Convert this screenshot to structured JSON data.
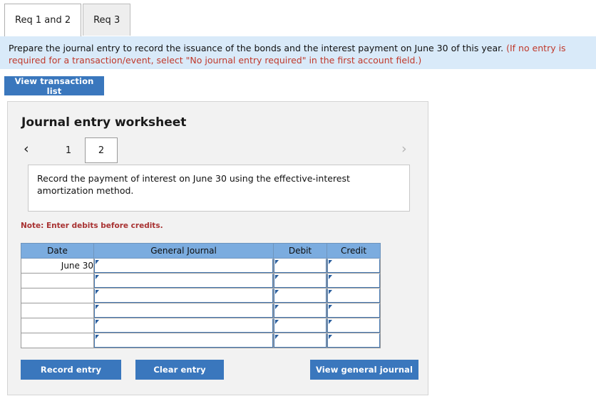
{
  "tabs": [
    {
      "label": "Req 1 and 2",
      "active": true
    },
    {
      "label": "Req 3",
      "active": false
    }
  ],
  "banner": {
    "main": "Prepare the journal entry to record the issuance of the bonds and the interest payment on June 30 of this year.",
    "hint": "(If no entry is required for a transaction/event, select \"No journal entry required\" in the first account field.)"
  },
  "toolbar": {
    "view_transaction_list_label": "View transaction list"
  },
  "worksheet": {
    "title": "Journal entry worksheet",
    "pager": {
      "prev_icon": "‹",
      "next_icon": "›",
      "pages": [
        "1",
        "2"
      ],
      "selected_page": "2"
    },
    "description": "Record the payment of interest on June 30 using the effective-interest amortization method.",
    "note": "Note: Enter debits before credits.",
    "table": {
      "columns": [
        "Date",
        "General Journal",
        "Debit",
        "Credit"
      ],
      "rows": [
        {
          "date": "June 30",
          "general_journal": "",
          "debit": "",
          "credit": ""
        },
        {
          "date": "",
          "general_journal": "",
          "debit": "",
          "credit": ""
        },
        {
          "date": "",
          "general_journal": "",
          "debit": "",
          "credit": ""
        },
        {
          "date": "",
          "general_journal": "",
          "debit": "",
          "credit": ""
        },
        {
          "date": "",
          "general_journal": "",
          "debit": "",
          "credit": ""
        },
        {
          "date": "",
          "general_journal": "",
          "debit": "",
          "credit": ""
        }
      ]
    },
    "buttons": {
      "record_entry": "Record entry",
      "clear_entry": "Clear entry",
      "view_general_journal": "View general journal"
    }
  },
  "colors": {
    "button_blue": "#3a77bd",
    "table_header_blue": "#7bacdf",
    "banner_bg": "#d9eaf9",
    "note_red": "#a83232",
    "panel_bg": "#f2f2f2"
  }
}
